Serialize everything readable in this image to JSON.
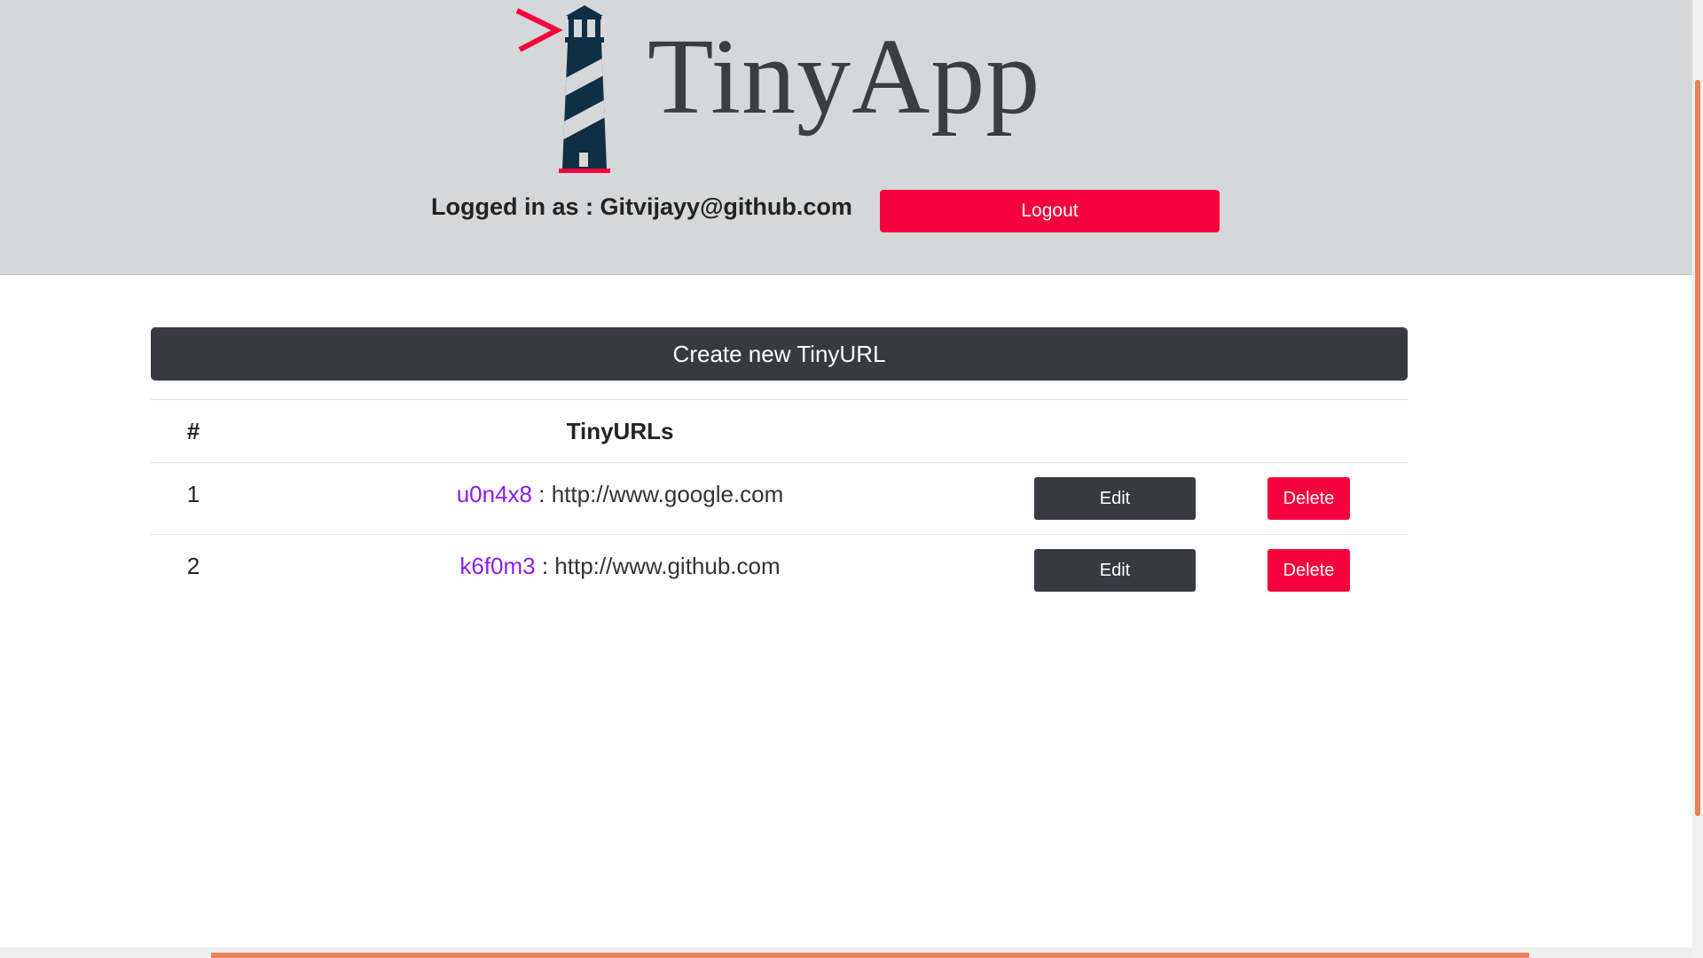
{
  "header": {
    "brand": "TinyApp",
    "logged_in_text": "Logged in as : Gitvijayy@github.com",
    "logout_label": "Logout"
  },
  "main": {
    "create_label": "Create new TinyURL",
    "table": {
      "headers": [
        "#",
        "TinyURLs"
      ],
      "rows": [
        {
          "num": "1",
          "short": "u0n4x8",
          "separator": " : ",
          "long": "http://www.google.com",
          "edit_label": "Edit",
          "delete_label": "Delete"
        },
        {
          "num": "2",
          "short": "k6f0m3",
          "separator": " : ",
          "long": "http://www.github.com",
          "edit_label": "Edit",
          "delete_label": "Delete"
        }
      ]
    }
  },
  "colors": {
    "header_bg": "#d5d7d9",
    "accent_red": "#f5023d",
    "dark_button": "#383a42",
    "link_purple": "#8a1cf2",
    "logo_navy": "#0f2f44"
  },
  "icons": {
    "logo": "lighthouse-logo-icon"
  }
}
